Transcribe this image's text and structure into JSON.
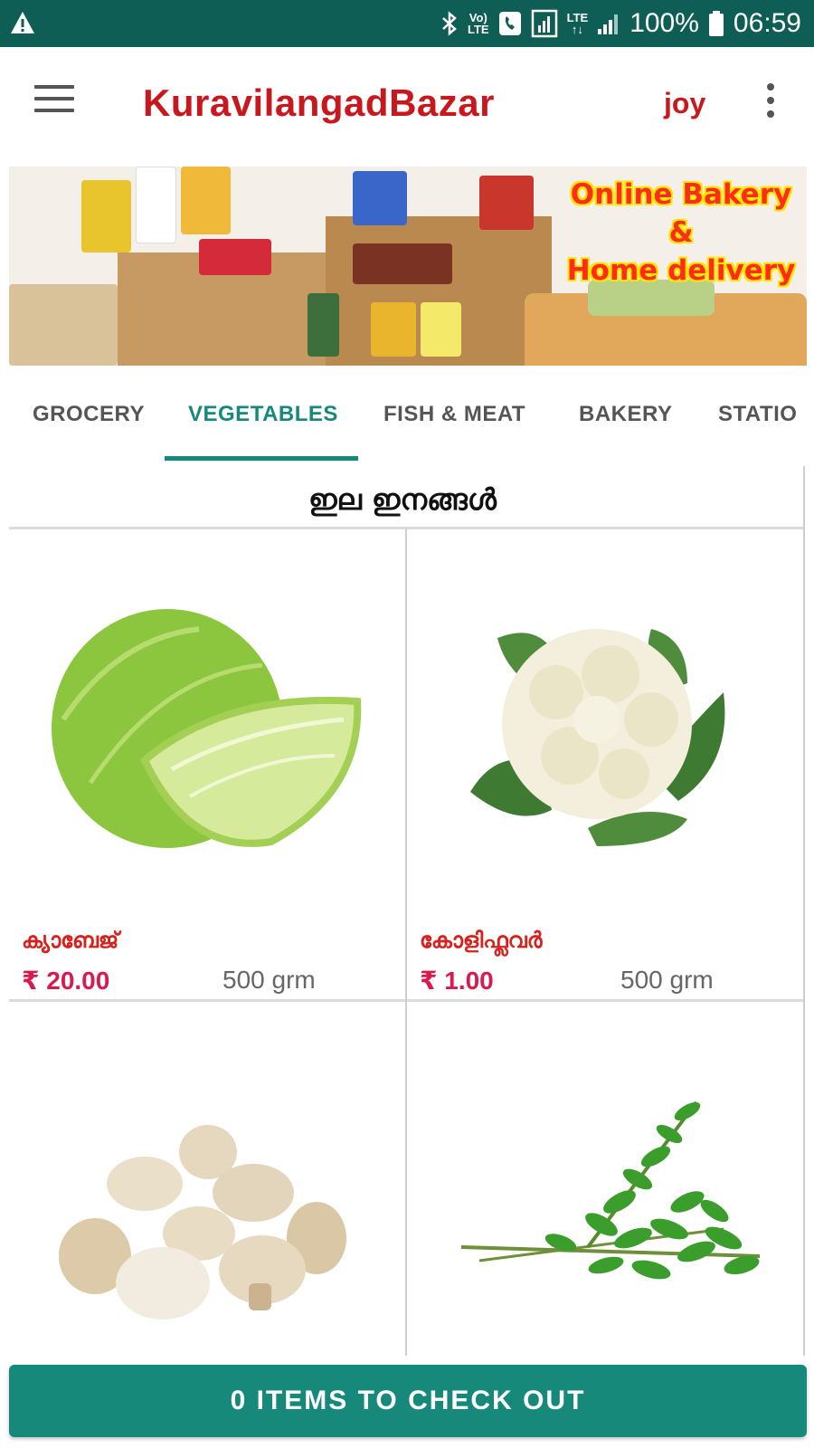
{
  "status_bar": {
    "network_label_top": "Vo)",
    "network_label_bottom": "LTE",
    "lte_label": "LTE",
    "battery": "100%",
    "time": "06:59"
  },
  "app_bar": {
    "title": "KuravilangadBazar",
    "user": "joy",
    "menu_icon": "hamburger-menu-icon",
    "overflow_icon": "more-vert-icon"
  },
  "banner": {
    "promo_line1": "Online Bakery",
    "promo_line2": "&",
    "promo_line3": "Home delivery"
  },
  "tabs": [
    {
      "label": "GROCERY",
      "active": false
    },
    {
      "label": "VEGETABLES",
      "active": true
    },
    {
      "label": "FISH & MEAT",
      "active": false
    },
    {
      "label": "BAKERY",
      "active": false
    },
    {
      "label": "STATIO",
      "active": false
    }
  ],
  "section": {
    "title": "ഇല ഇനങ്ങൾ"
  },
  "products": [
    {
      "name": "ക്യാബേജ്",
      "price": "₹ 20.00",
      "unit": "500 grm",
      "image": "cabbage"
    },
    {
      "name": "കോളിഫ്ലവർ",
      "price": "₹ 1.00",
      "unit": "500 grm",
      "image": "cauliflower"
    },
    {
      "image": "mushroom"
    },
    {
      "image": "curry-leaves"
    }
  ],
  "checkout": {
    "label": "0 ITEMS TO CHECK OUT"
  },
  "colors": {
    "status_bar": "#0f5e55",
    "accent": "#16897b",
    "title_red": "#c8181e",
    "price": "#d91a4e"
  }
}
